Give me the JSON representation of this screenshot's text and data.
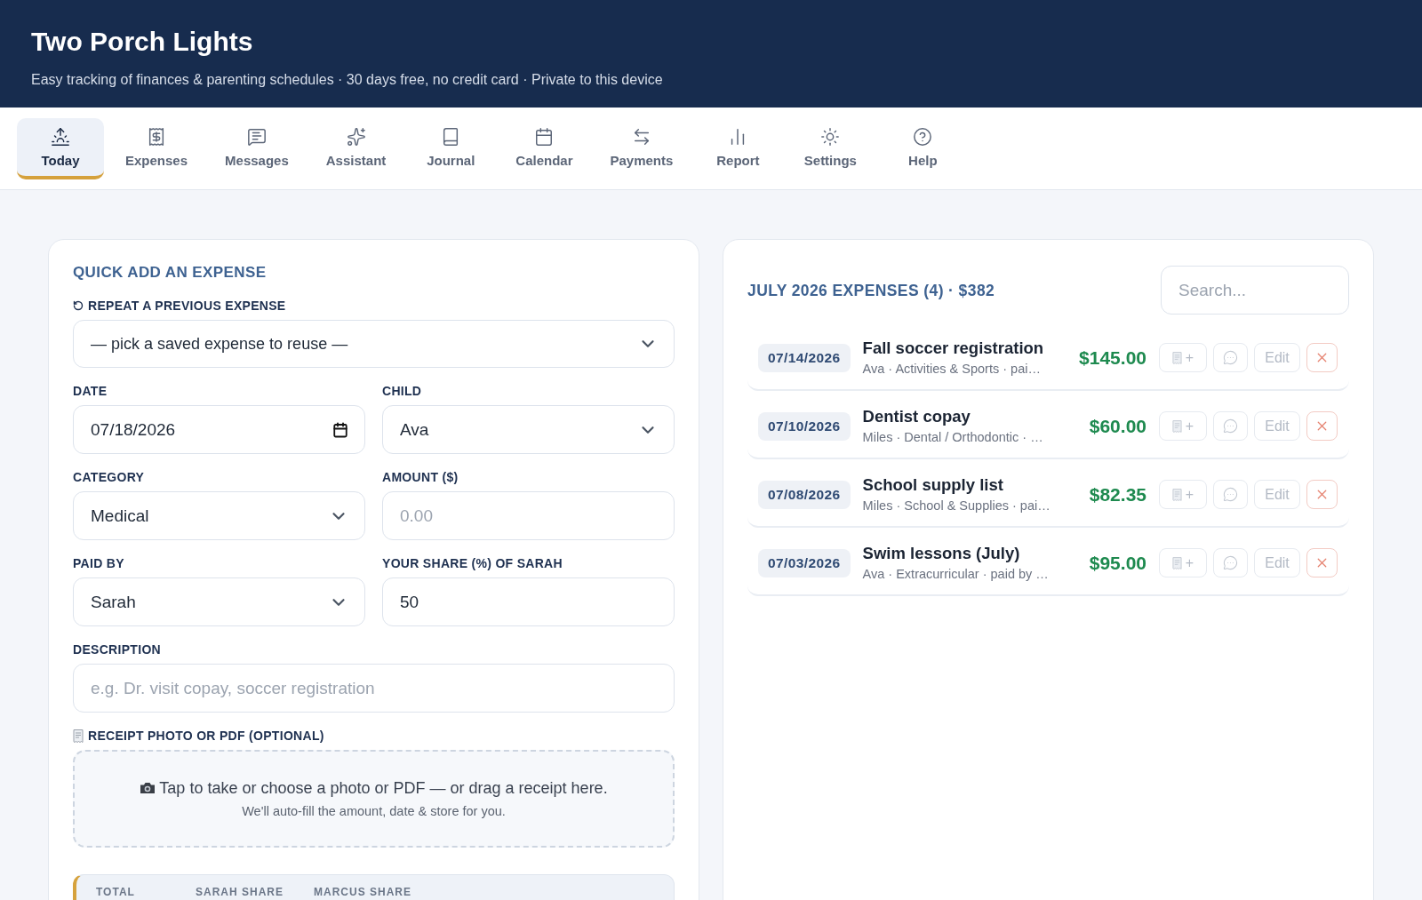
{
  "app": {
    "title": "Two Porch Lights",
    "tagline": "Easy tracking of finances & parenting schedules · 30 days free, no credit card · Private to this device"
  },
  "tabs": [
    {
      "label": "Today",
      "selected": true
    },
    {
      "label": "Expenses",
      "selected": false
    },
    {
      "label": "Messages",
      "selected": false
    },
    {
      "label": "Assistant",
      "selected": false
    },
    {
      "label": "Journal",
      "selected": false
    },
    {
      "label": "Calendar",
      "selected": false
    },
    {
      "label": "Payments",
      "selected": false
    },
    {
      "label": "Report",
      "selected": false
    },
    {
      "label": "Settings",
      "selected": false
    },
    {
      "label": "Help",
      "selected": false
    }
  ],
  "quick_add": {
    "title": "QUICK ADD AN EXPENSE",
    "repeat": {
      "label": "REPEAT A PREVIOUS EXPENSE",
      "value": "— pick a saved expense to reuse —"
    },
    "fields": [
      {
        "label": "DATE",
        "kind": "date",
        "value": "07/18/2026"
      },
      {
        "label": "CHILD",
        "kind": "select",
        "value": "Ava"
      },
      {
        "label": "CATEGORY",
        "kind": "select",
        "value": "Medical"
      },
      {
        "label": "AMOUNT ($)",
        "kind": "text",
        "placeholder": "0.00"
      },
      {
        "label": "PAID BY",
        "kind": "select",
        "value": "Sarah"
      },
      {
        "label": "YOUR SHARE (%) OF SARAH",
        "kind": "text",
        "value": "50"
      }
    ],
    "description": {
      "label": "DESCRIPTION",
      "placeholder": "e.g. Dr. visit copay, soccer registration"
    },
    "receipt": {
      "label": "RECEIPT PHOTO OR PDF (OPTIONAL)",
      "prompt": "Tap to take or choose a photo or PDF — or drag a receipt here.",
      "hint": "We'll auto-fill the amount, date & store for you."
    },
    "summary": {
      "columns": [
        "TOTAL",
        "SARAH SHARE",
        "MARCUS SHARE"
      ]
    }
  },
  "expenses": {
    "title": "JULY 2026 EXPENSES (4) · $382",
    "search": {
      "placeholder": "Search..."
    },
    "rows": [
      {
        "date": "07/14/2026",
        "title": "Fall soccer registration",
        "details": "Ava · Activities & Sports · pai…",
        "amount": "$145.00",
        "receipt_button": "+",
        "edit_button": "Edit"
      },
      {
        "date": "07/10/2026",
        "title": "Dentist copay",
        "details": "Miles · Dental / Orthodontic · …",
        "amount": "$60.00",
        "receipt_button": "+",
        "edit_button": "Edit"
      },
      {
        "date": "07/08/2026",
        "title": "School supply list",
        "details": "Miles · School & Supplies · pai…",
        "amount": "$82.35",
        "receipt_button": "+",
        "edit_button": "Edit"
      },
      {
        "date": "07/03/2026",
        "title": "Swim lessons (July)",
        "details": "Ava · Extracurricular · paid by …",
        "amount": "$95.00",
        "receipt_button": "+",
        "edit_button": "Edit"
      }
    ]
  }
}
